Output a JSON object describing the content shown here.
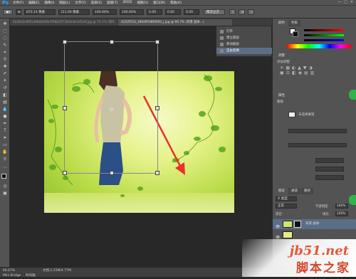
{
  "app": {
    "logo": "Ps"
  },
  "menu": [
    "文件(F)",
    "编辑(E)",
    "图像(I)",
    "图层(L)",
    "文字(Y)",
    "选择(S)",
    "滤镜(T)",
    "3D(D)",
    "视图(V)",
    "窗口(W)",
    "帮助(H)"
  ],
  "window_controls": [
    "—",
    "□",
    "✕"
  ],
  "options": {
    "x": "870.14 像素",
    "y": "311.00 像素",
    "w": "100.00%",
    "h": "100.00%",
    "angle": "0.00",
    "hskew": "0.00",
    "vskew": "0.00",
    "interp": "两次立方"
  },
  "tabs": [
    "8a48d2c8f91a9b6bbf0b7f48b2073bfdc8e3d5c8.jpg @ 70.1% (绿叶, 图层 0, RGB/8)",
    "4252f15d_189d9548f0000_j.jpg @ 66.7% (背景 副本...)"
  ],
  "history": {
    "items": [
      "打开",
      "建立图层",
      "移动图层",
      "自由变换"
    ],
    "active_index": 3
  },
  "panels": {
    "color_tab": "颜色",
    "swatches_tab": "色板",
    "adjust_tab": "调整",
    "adjust_head": "添加调整",
    "props_tab": "属性",
    "props_sub": "蒙版",
    "props_label": "未选择蒙版",
    "layers_tab": "图层",
    "channels_tab": "通道",
    "paths_tab": "路径",
    "blend_mode": "正常",
    "opacity_label": "不透明度:",
    "opacity": "100%",
    "fill_label": "填充:",
    "fill": "100%",
    "lock_label": "锁定:",
    "layers": [
      {
        "name": "背景 副本",
        "active": true
      },
      {
        "name": "",
        "active": false
      }
    ]
  },
  "status": {
    "zoom": "66.67%",
    "doc": "文档:2.25M/4.77M",
    "mini_bridge": "Mini Bridge",
    "timeline": "时间轴"
  },
  "watermark": {
    "line1": "jb51.net",
    "line2": "脚本之家"
  },
  "colors": {
    "accent": "#2fa3ff",
    "history_active": "#5b6e88",
    "arrow": "#e8322a"
  }
}
